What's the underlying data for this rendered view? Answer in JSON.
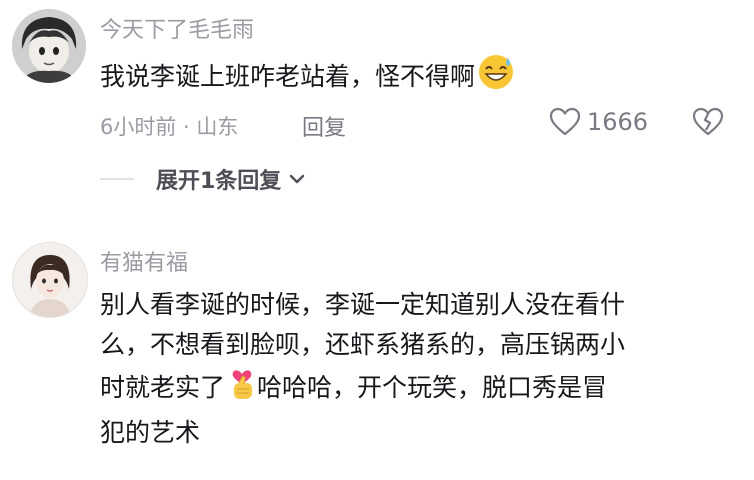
{
  "comments": [
    {
      "username": "今天下了毛毛雨",
      "text": "我说李诞上班咋老站着，怪不得啊",
      "emoji": "grinning-sweat-emoji",
      "time_location": "6小时前 · 山东",
      "reply_label": "回复",
      "likes": "1666",
      "expand_label": "展开1条回复"
    },
    {
      "username": "有猫有福",
      "text_lines": [
        "别人看李诞的时候，李诞一定知道别人没在看什",
        "么，不想看到脸呗，还虾系猪系的，高压锅两小",
        "时就老实了",
        "哈哈哈，开个玩笑，脱口秀是冒",
        "犯的艺术"
      ],
      "emoji": "finger-heart-emoji"
    }
  ],
  "colors": {
    "text": "#17171c",
    "muted": "#9b9ba3",
    "icon": "#7a7a82"
  }
}
